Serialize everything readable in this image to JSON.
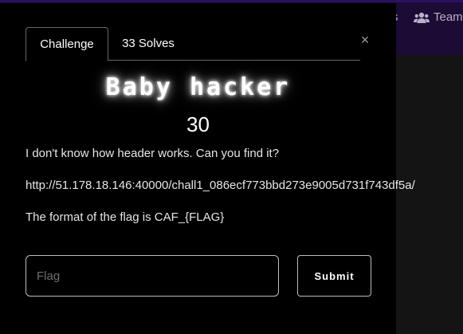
{
  "navbar": {
    "partial_item_label": "s",
    "teams_label": "Teams",
    "teams_icon": "users-icon",
    "background_color": "#1b0b35"
  },
  "modal": {
    "close_symbol": "×",
    "close_icon": "close-icon",
    "tabs": [
      {
        "label": "Challenge",
        "active": true
      },
      {
        "label": "33 Solves",
        "active": false
      }
    ],
    "title": "Baby hacker",
    "points": "30",
    "description": [
      "I don't know how header works. Can you find it?",
      "http://51.178.18.146:40000/chall1_086ecf773bbd273e9005d731f743df5a/",
      "The format of the flag is CAF_{FLAG}"
    ],
    "flag_input": {
      "placeholder": "Flag",
      "value": ""
    },
    "submit_label": "Submit"
  }
}
